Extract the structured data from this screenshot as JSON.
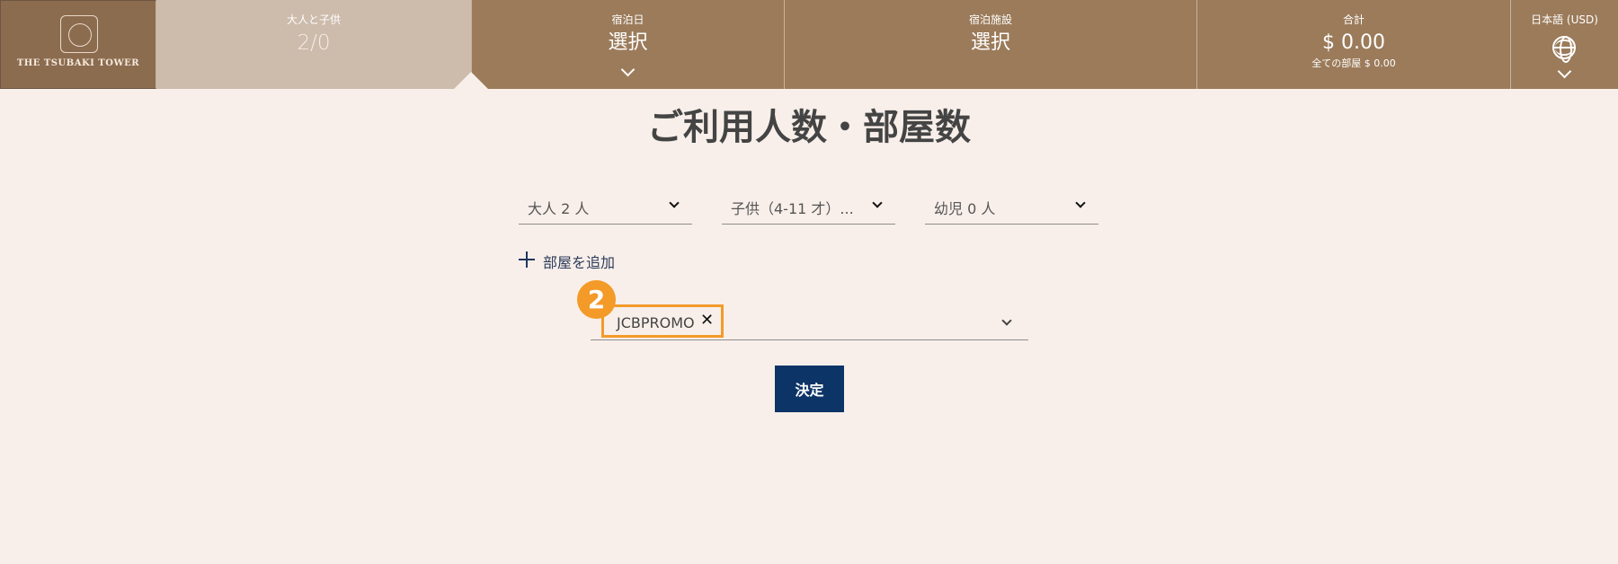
{
  "header": {
    "logo_text": "THE TSUBAKI TOWER",
    "guests": {
      "label": "大人と子供",
      "value": "2/0"
    },
    "dates": {
      "label": "宿泊日",
      "value": "選択"
    },
    "hotel": {
      "label": "宿泊施設",
      "value": "選択"
    },
    "total": {
      "label": "合計",
      "value": "$ 0.00",
      "sub": "全ての部屋 $ 0.00"
    },
    "language": {
      "label": "日本語 (USD)"
    }
  },
  "main": {
    "title": "ご利用人数・部屋数",
    "selects": {
      "adults": "大人 2 人",
      "children": "子供（4-11 才）...",
      "infants": "幼児 0 人"
    },
    "add_room_label": "部屋を追加",
    "promo": {
      "chip": "JCBPROMO",
      "remove": "✕",
      "step_badge": "2"
    },
    "submit_label": "決定"
  },
  "colors": {
    "header_bg": "#9b7b5a",
    "active_tab": "#cdbbab",
    "page_bg": "#f8efea",
    "primary_button": "#0d3467",
    "highlight": "#f39a29"
  }
}
